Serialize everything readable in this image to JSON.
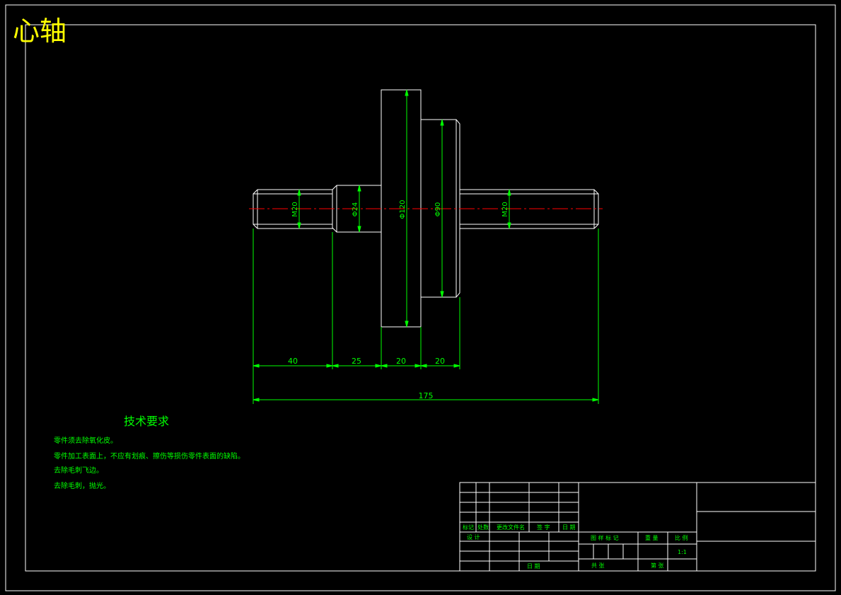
{
  "title": "心轴",
  "colors": {
    "background": "#000000",
    "outline": "#ffffff",
    "dimension": "#00ff00",
    "centerline": "#ff0000",
    "title": "#ffff00"
  },
  "part_labels": {
    "thread_left": "M20",
    "shaft_24": "Φ24",
    "flange_120": "Φ120",
    "hub_90": "Φ90",
    "thread_right": "M20"
  },
  "dimensions": {
    "d1": "40",
    "d2": "25",
    "d3": "20",
    "d4": "20",
    "total": "175"
  },
  "technical_requirements": {
    "heading": "技术要求",
    "items": [
      "零件须去除氧化皮。",
      "零件加工表面上，不应有划痕、擦伤等损伤零件表面的缺陷。",
      "去除毛刺飞边。",
      "去除毛刺，抛光。"
    ]
  },
  "title_block": {
    "mark": "标记",
    "count": "处数",
    "change_doc": "更改文件名",
    "signature": "签 字",
    "date": "日 期",
    "design": "设 计",
    "approve_date": "日 期",
    "stage_mark": "图 样 标 记",
    "weight": "重 量",
    "scale": "比 例",
    "scale_value": "1:1",
    "total_sheets": "共 张",
    "sheet": "第 张"
  }
}
